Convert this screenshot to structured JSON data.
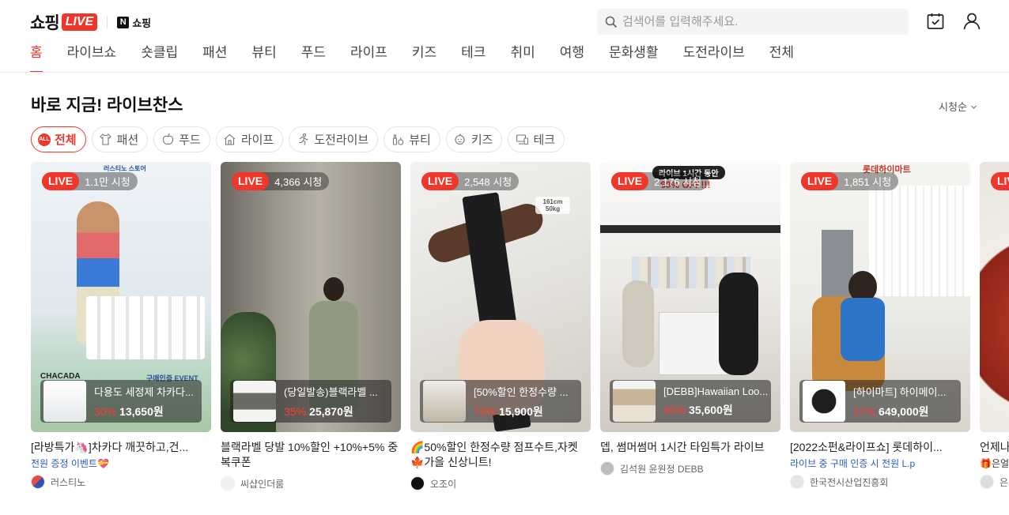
{
  "header": {
    "logo_text": "쇼핑",
    "logo_live": "LIVE",
    "n_badge": "N",
    "n_text": "쇼핑",
    "search_placeholder": "검색어를 입력해주세요."
  },
  "nav": [
    "홈",
    "라이브쇼",
    "숏클립",
    "패션",
    "뷰티",
    "푸드",
    "라이프",
    "키즈",
    "테크",
    "취미",
    "여행",
    "문화생활",
    "도전라이브",
    "전체"
  ],
  "section": {
    "title": "바로 지금! 라이브찬스",
    "sort": "시청순"
  },
  "chips": [
    {
      "label": "전체",
      "icon": "all-icon",
      "icon_text": "ALL"
    },
    {
      "label": "패션",
      "icon": "shirt-icon"
    },
    {
      "label": "푸드",
      "icon": "apple-icon"
    },
    {
      "label": "라이프",
      "icon": "house-icon"
    },
    {
      "label": "도전라이브",
      "icon": "runner-icon"
    },
    {
      "label": "뷰티",
      "icon": "cosmetics-icon"
    },
    {
      "label": "키즈",
      "icon": "baby-icon"
    },
    {
      "label": "테크",
      "icon": "monitor-icon"
    }
  ],
  "cards": [
    {
      "live": "LIVE",
      "viewers": "1.1만 시청",
      "product": "다용도 세정제 차카다...",
      "discount": "30%",
      "price": "13,650원",
      "title": "[라방특가🦄]차카다 깨끗하고,건...",
      "tag": "전원 증정 이벤트💝",
      "seller": "러스티노",
      "thumb_top": "러스티노 스토어",
      "thumb_bottom": "CHACADA",
      "thumb_event": "구매인증 EVENT"
    },
    {
      "live": "LIVE",
      "viewers": "4,366 시청",
      "product": "(당일발송)블랙라벨 ...",
      "discount": "35%",
      "price": "25,870원",
      "title": "블랙라벨 당발 10%할인 +10%+5% 중복쿠폰",
      "tag": "",
      "seller": "씨샵인더룸"
    },
    {
      "live": "LIVE",
      "viewers": "2,548 시청",
      "product": "[50%할인 한정수량 ...",
      "discount": "73%",
      "price": "15,900원",
      "title": "🌈50%할인 한정수량 점프수트,자켓🍁가을 신상니트!",
      "tag": "",
      "seller": "오조이",
      "thumb_size": "161cm 50kg"
    },
    {
      "live": "LIVE",
      "viewers": "2,176 시청",
      "product": "[DEBB]Hawaiian Loo...",
      "discount": "60%",
      "price": "35,600원",
      "title": "뎁, 썸머썸머 1시간 타임특가 라이브",
      "tag": "",
      "seller": "김석원 윤원정 DEBB",
      "thumb_banner1": "라이브 1시간 동안",
      "thumb_banner2": "60% OFF!!!"
    },
    {
      "live": "LIVE",
      "viewers": "1,851 시청",
      "product": "[하이마트] 하이메이...",
      "discount": "17%",
      "price": "649,000원",
      "title": "[2022소펀&라이프쇼] 롯데하이...",
      "tag": "라이브 중 구매 인증 시 전원 L.p",
      "seller": "한국전시산업진흥회",
      "thumb_brand": "롯데하이마트"
    },
    {
      "live": "LIVE",
      "viewers": "",
      "product": "",
      "discount": "",
      "price": "",
      "title": "언제나",
      "tag": "🎁은얼",
      "seller": "은"
    }
  ]
}
